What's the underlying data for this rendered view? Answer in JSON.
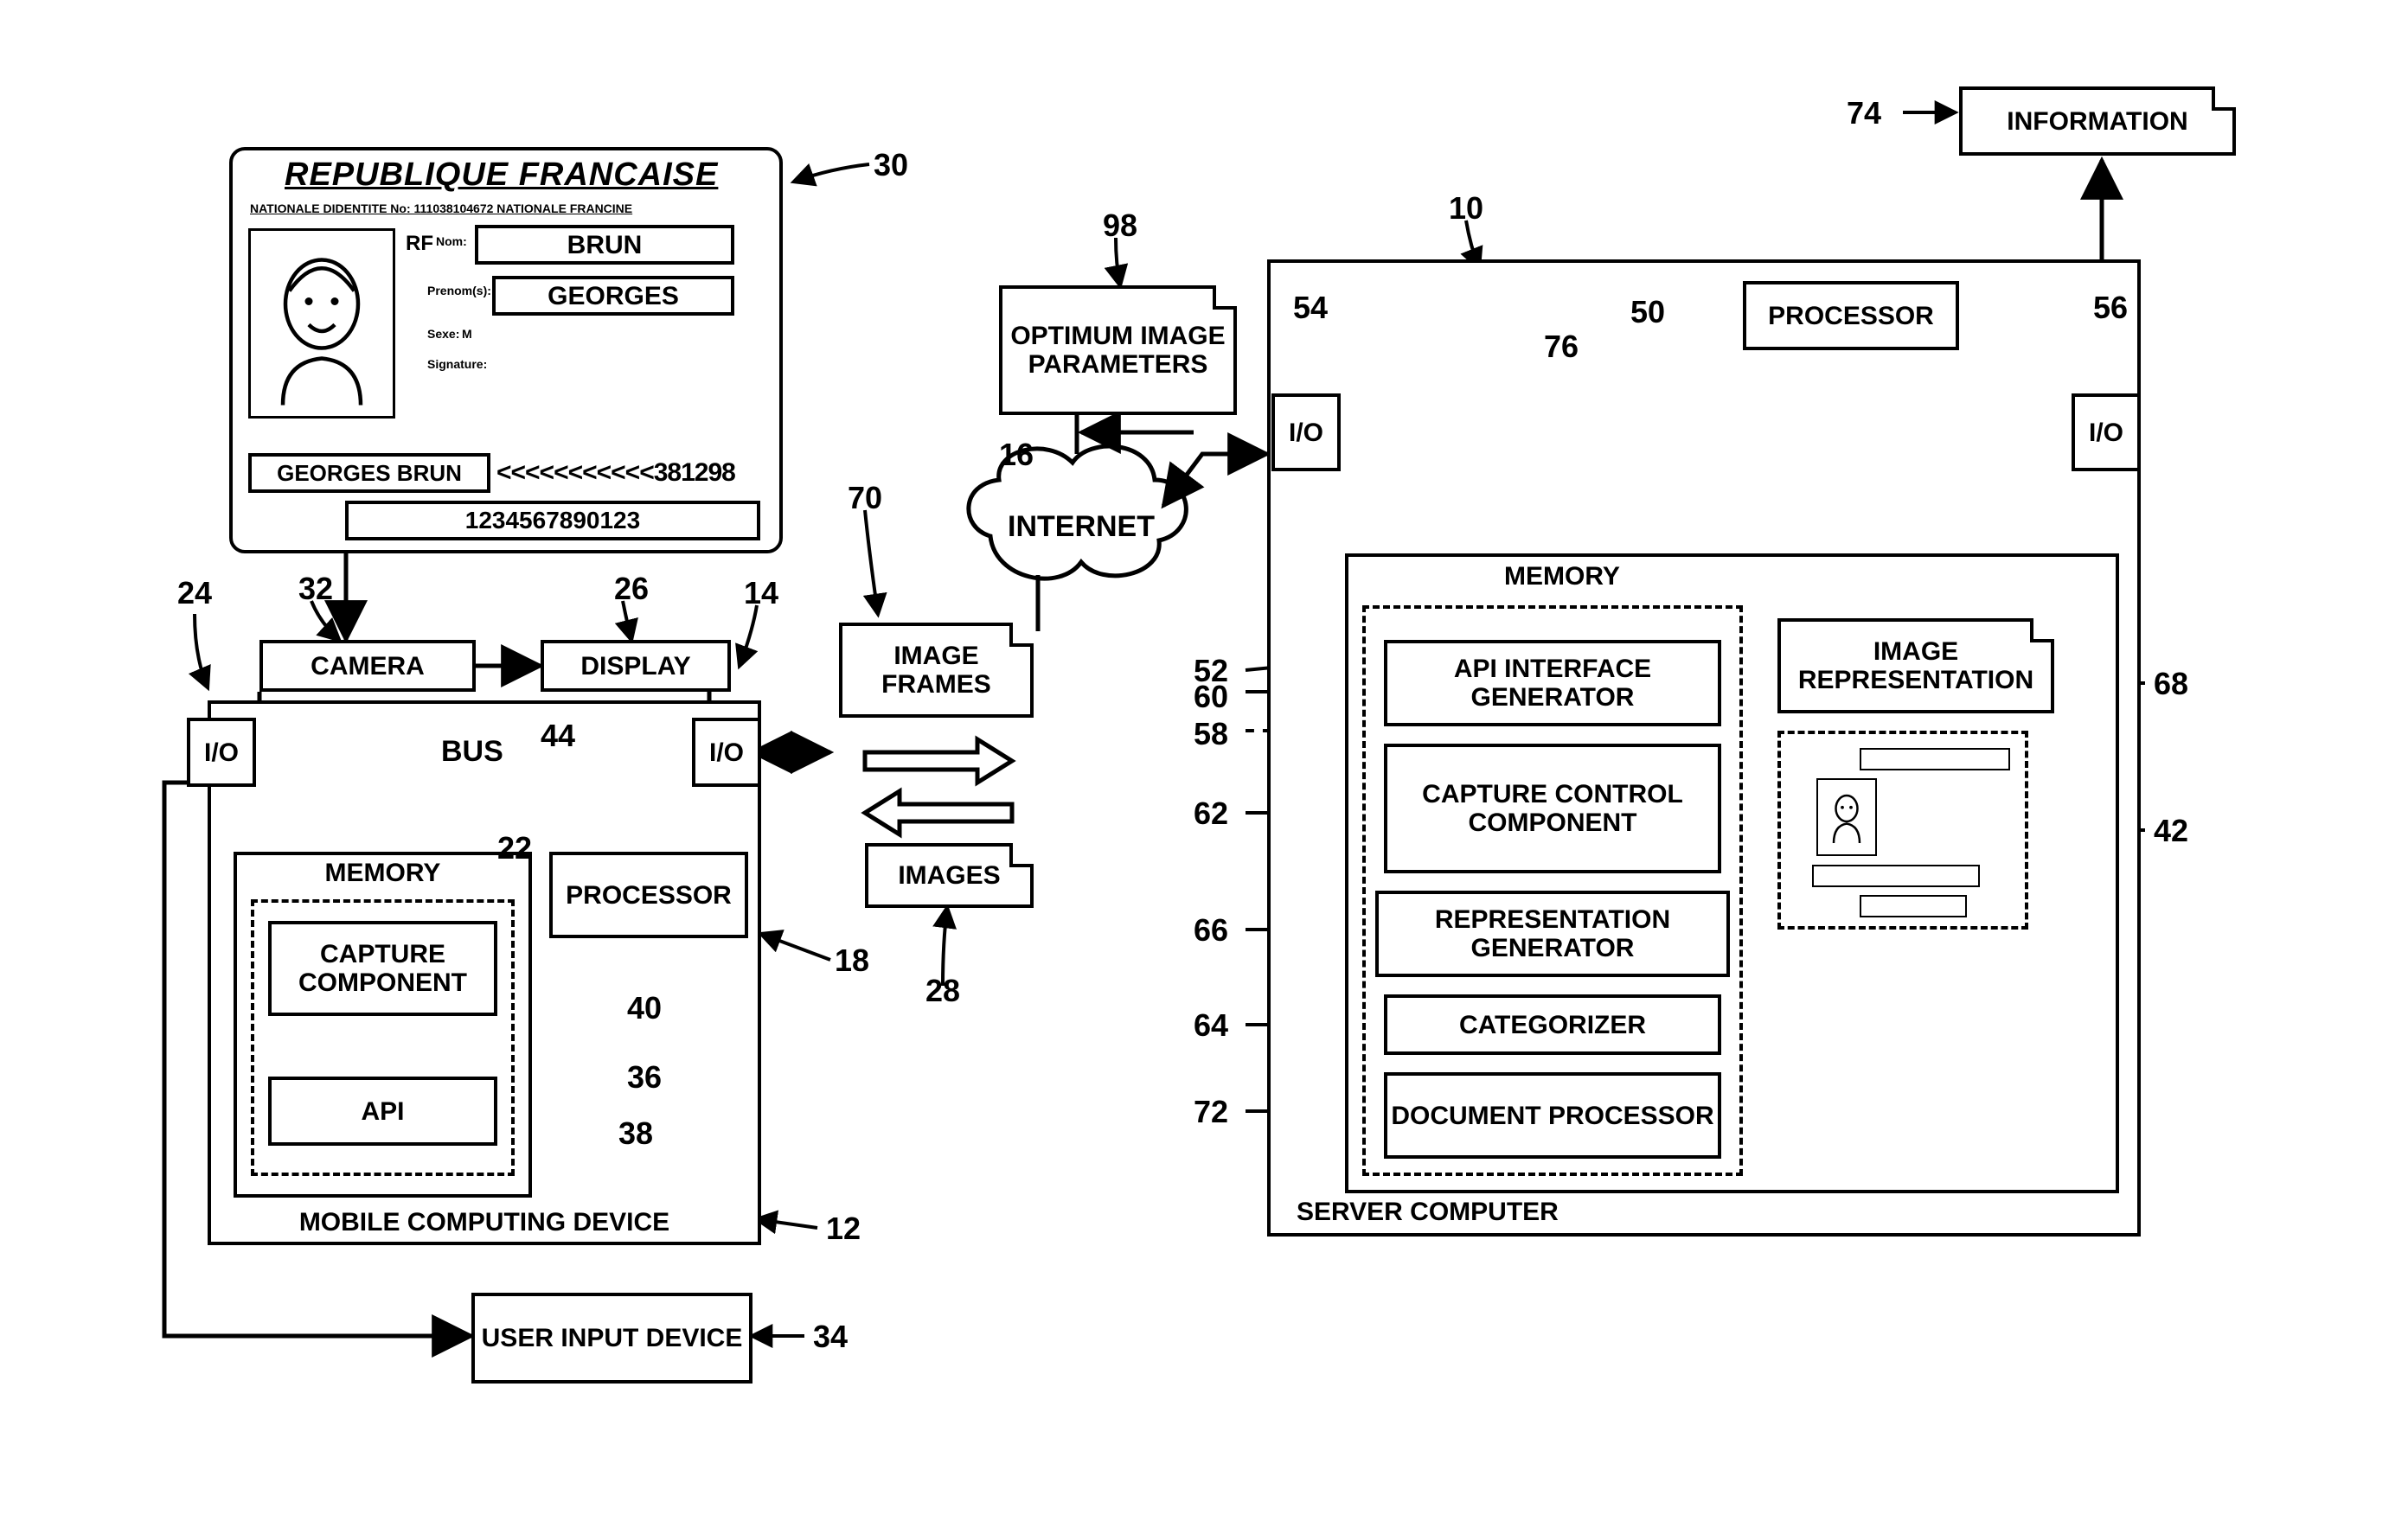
{
  "card": {
    "country": "REPUBLIQUE FRANCAISE",
    "idline": "NATIONALE DIDENTITE No: 111038104672   NATIONALE FRANCINE",
    "rf": "RF",
    "nom_lbl": "Nom:",
    "nom": "BRUN",
    "prenom_lbl": "Prenom(s):",
    "prenom": "GEORGES",
    "sexe_lbl": "Sexe:",
    "sexe": "M",
    "sig_lbl": "Signature:",
    "mrz1": "GEORGES BRUN",
    "mrz1b": "<<<<<<<<<<<381298",
    "mrz2": "1234567890123"
  },
  "mobile": {
    "camera": "CAMERA",
    "display": "DISPLAY",
    "io_left": "I/O",
    "io_right": "I/O",
    "bus": "BUS",
    "memory": "MEMORY",
    "capture": "CAPTURE COMPONENT",
    "api": "API",
    "processor": "PROCESSOR",
    "title": "MOBILE COMPUTING DEVICE",
    "user_input": "USER INPUT DEVICE"
  },
  "middle": {
    "optimum": "OPTIMUM IMAGE PARAMETERS",
    "internet": "INTERNET",
    "image_frames": "IMAGE FRAMES",
    "images": "IMAGES"
  },
  "server": {
    "title": "SERVER COMPUTER",
    "processor": "PROCESSOR",
    "io_left": "I/O",
    "io_right": "I/O",
    "memory": "MEMORY",
    "api_gen": "API INTERFACE GENERATOR",
    "capture_ctrl": "CAPTURE CONTROL COMPONENT",
    "rep_gen": "REPRESENTATION GENERATOR",
    "categorizer": "CATEGORIZER",
    "doc_proc": "DOCUMENT PROCESSOR",
    "img_rep": "IMAGE REPRESENTATION",
    "information": "INFORMATION"
  },
  "refs": {
    "r10": "10",
    "r12": "12",
    "r14": "14",
    "r16": "16",
    "r18": "18",
    "r22": "22",
    "r24": "24",
    "r26": "26",
    "r28": "28",
    "r30": "30",
    "r32": "32",
    "r34": "34",
    "r36": "36",
    "r38": "38",
    "r40": "40",
    "r42": "42",
    "r44": "44",
    "r50": "50",
    "r52": "52",
    "r54": "54",
    "r56": "56",
    "r58": "58",
    "r60": "60",
    "r62": "62",
    "r64": "64",
    "r66": "66",
    "r68": "68",
    "r70": "70",
    "r72": "72",
    "r74": "74",
    "r76": "76",
    "r98": "98"
  },
  "chart_data": {
    "type": "diagram",
    "note": "Patent-style system block diagram (not a numeric chart).",
    "nodes": [
      {
        "ref": 30,
        "name": "ID card (Republique Francaise)"
      },
      {
        "ref": 12,
        "name": "Mobile Computing Device",
        "children": [
          {
            "ref": 32,
            "name": "Camera"
          },
          {
            "ref": 26,
            "name": "Display"
          },
          {
            "ref": 24,
            "name": "I/O (left)"
          },
          {
            "ref": 14,
            "name": "I/O (right)"
          },
          {
            "ref": 44,
            "name": "Bus"
          },
          {
            "ref": 22,
            "name": "Memory",
            "children": [
              {
                "ref": 40,
                "name": "Capture Component"
              },
              {
                "ref": 38,
                "name": "API"
              },
              {
                "ref": 36,
                "name": "Memory dashed group"
              }
            ]
          },
          {
            "ref": 18,
            "name": "Processor"
          }
        ]
      },
      {
        "ref": 34,
        "name": "User Input Device"
      },
      {
        "ref": 98,
        "name": "Optimum Image Parameters"
      },
      {
        "ref": 16,
        "name": "Internet"
      },
      {
        "ref": 70,
        "name": "Image Frames"
      },
      {
        "ref": 28,
        "name": "Images"
      },
      {
        "ref": 10,
        "name": "Server Computer",
        "children": [
          {
            "ref": 50,
            "name": "Processor"
          },
          {
            "ref": 54,
            "name": "I/O (left)"
          },
          {
            "ref": 56,
            "name": "I/O (right)"
          },
          {
            "ref": 76,
            "name": "Server bus"
          },
          {
            "ref": 52,
            "name": "Memory",
            "children": [
              {
                "ref": 60,
                "name": "API Interface Generator"
              },
              {
                "ref": 58,
                "name": "Memory dashed group"
              },
              {
                "ref": 62,
                "name": "Capture Control Component"
              },
              {
                "ref": 66,
                "name": "Representation Generator"
              },
              {
                "ref": 64,
                "name": "Categorizer"
              },
              {
                "ref": 72,
                "name": "Document Processor"
              }
            ]
          },
          {
            "ref": 68,
            "name": "Image Representation"
          },
          {
            "ref": 42,
            "name": "Representation thumbnail"
          }
        ]
      },
      {
        "ref": 74,
        "name": "Information"
      }
    ],
    "edges": [
      {
        "from": 32,
        "to": 26,
        "label": "camera→display"
      },
      {
        "from": 24,
        "to": 14,
        "via": 44,
        "label": "bus"
      },
      {
        "from": 44,
        "to": 22,
        "label": "bus↔memory"
      },
      {
        "from": 44,
        "to": 18,
        "label": "bus↔processor"
      },
      {
        "from": 14,
        "to": 70,
        "label": "image frames out"
      },
      {
        "from": 14,
        "to": 28,
        "label": "images in"
      },
      {
        "from": 16,
        "to": 98,
        "label": "internet↔params"
      },
      {
        "from": 16,
        "to": 54,
        "label": "internet↔server I/O"
      },
      {
        "from": 54,
        "to": 56,
        "via": 76,
        "label": "server bus"
      },
      {
        "from": 76,
        "to": 50,
        "label": "bus↔processor"
      },
      {
        "from": 76,
        "to": 52,
        "label": "bus↔memory"
      },
      {
        "from": 56,
        "to": 74,
        "label": "server→information"
      },
      {
        "from": 12,
        "to": 34,
        "label": "device↔user input"
      }
    ]
  }
}
